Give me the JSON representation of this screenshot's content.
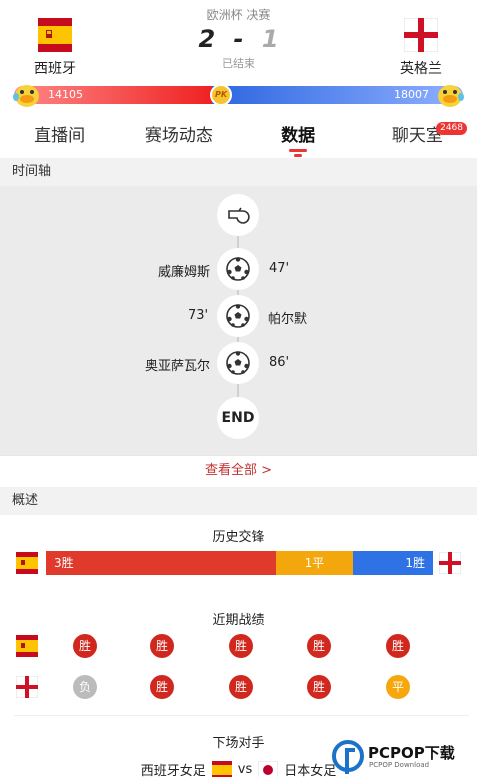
{
  "match": {
    "competition": "欧洲杯 决赛",
    "home_score": "2",
    "separator": "-",
    "away_score": "1",
    "status": "已结束"
  },
  "home_team": {
    "name": "西班牙",
    "flag": "spain-flag"
  },
  "away_team": {
    "name": "英格兰",
    "flag": "england-flag"
  },
  "pk": {
    "home_value": "14105",
    "away_value": "18007",
    "badge": "PK",
    "home_share": 0.44,
    "home_color": "#e22222",
    "away_color": "#2d66e0"
  },
  "tabs": [
    {
      "label": "直播间"
    },
    {
      "label": "赛场动态"
    },
    {
      "label": "数据",
      "active": true
    },
    {
      "label": "聊天室",
      "badge": "2468"
    }
  ],
  "timeline": {
    "header": "时间轴",
    "events": [
      {
        "type": "whistle-icon"
      },
      {
        "type": "goal",
        "side": "home",
        "player": "威廉姆斯",
        "minute": "47'"
      },
      {
        "type": "goal",
        "side": "away",
        "player": "帕尔默",
        "minute": "73'"
      },
      {
        "type": "goal",
        "side": "home",
        "player": "奥亚萨瓦尔",
        "minute": "86'"
      },
      {
        "type": "end",
        "label": "END"
      }
    ],
    "view_all": "查看全部 >"
  },
  "overview": {
    "header": "概述",
    "h2h_title": "历史交锋",
    "h2h": {
      "wins": "3胜",
      "draws": "1平",
      "losses": "1胜",
      "win_count": 3,
      "draw_count": 1,
      "loss_count": 1
    },
    "recent_title": "近期战绩",
    "home_form": [
      "胜",
      "胜",
      "胜",
      "胜",
      "胜"
    ],
    "away_form": [
      "负",
      "胜",
      "胜",
      "胜",
      "平"
    ],
    "next_title": "下场对手",
    "next_home": "西班牙女足",
    "next_vs": "vs",
    "next_away": "日本女足"
  },
  "colors": {
    "win": "#d0281f",
    "loss": "#bbbbbb",
    "draw": "#f5a70c",
    "accent": "#e33333"
  },
  "watermark": {
    "brand": "PCPOP下载",
    "sub": "PCPOP Download"
  }
}
